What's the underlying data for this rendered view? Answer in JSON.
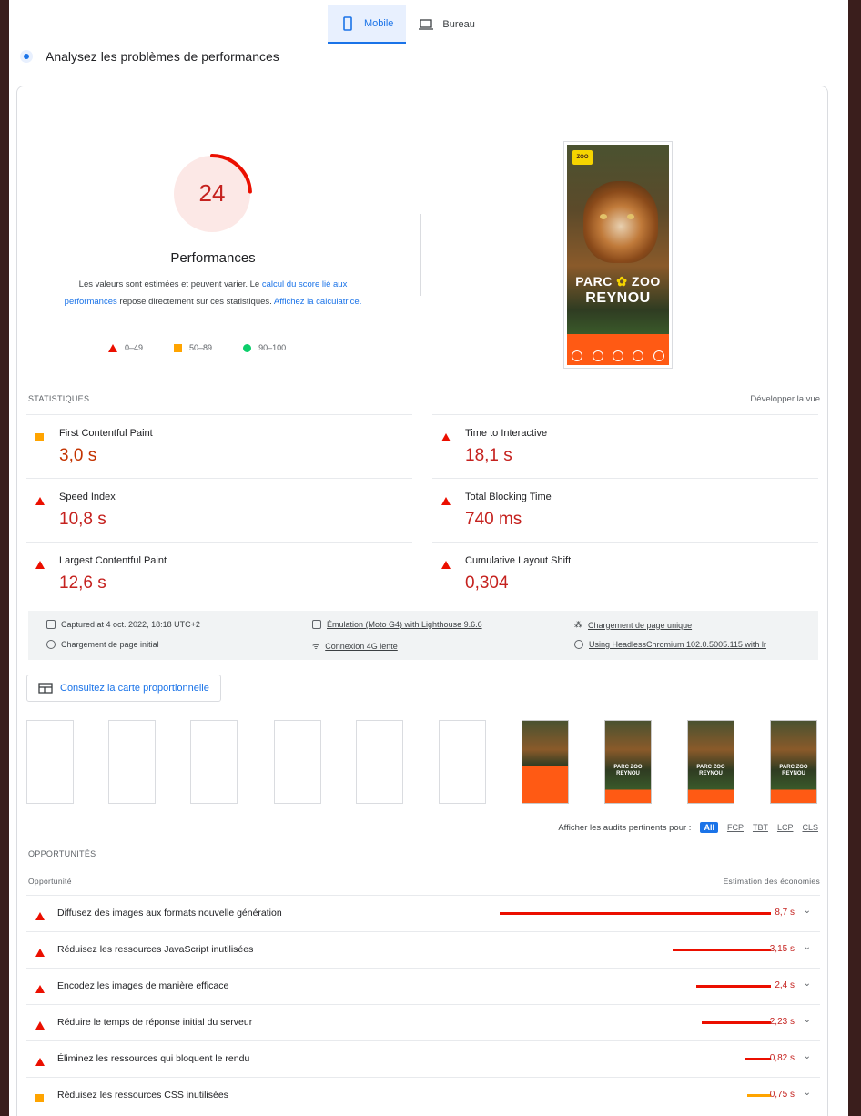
{
  "tabs": [
    {
      "label": "Mobile",
      "active": true
    },
    {
      "label": "Bureau",
      "active": false
    }
  ],
  "headline": "Analysez les problèmes de performances",
  "score": {
    "value": "24",
    "fraction": 0.24,
    "title": "Performances",
    "desc_1": "Les valeurs sont estimées et peuvent varier. Le ",
    "desc_link_1": "calcul du score lié aux performances",
    "desc_2": " repose directement sur ces statistiques. ",
    "desc_link_2": "Affichez la calculatrice."
  },
  "legend": {
    "low": "0–49",
    "mid": "50–89",
    "high": "90–100"
  },
  "screenshot": {
    "logo": "ZOO",
    "line1": "PARC",
    "line1b": "ZOO",
    "line2": "REYNOU"
  },
  "stats": {
    "label": "STATISTIQUES",
    "expand": "Développer la vue",
    "metrics": [
      {
        "name": "First Contentful Paint",
        "value": "3,0 s",
        "level": "average"
      },
      {
        "name": "Time to Interactive",
        "value": "18,1 s",
        "level": "fail"
      },
      {
        "name": "Speed Index",
        "value": "10,8 s",
        "level": "fail"
      },
      {
        "name": "Total Blocking Time",
        "value": "740 ms",
        "level": "fail"
      },
      {
        "name": "Largest Contentful Paint",
        "value": "12,6 s",
        "level": "fail"
      },
      {
        "name": "Cumulative Layout Shift",
        "value": "0,304",
        "level": "fail"
      }
    ]
  },
  "info": {
    "captured": "Captured at 4 oct. 2022, 18:18 UTC+2",
    "initial_load": "Chargement de page initial",
    "emulation": "Émulation (Moto G4) with Lighthouse 9.6.6",
    "connection": "Connexion 4G lente",
    "single_load": "Chargement de page unique",
    "browser": "Using HeadlessChromium 102.0.5005.115 with lr"
  },
  "treemap_label": "Consultez la carte proportionnelle",
  "filmstrip_text": "PARC ZOO REYNOU",
  "filters": {
    "label": "Afficher les audits pertinents pour :",
    "chips": [
      "All",
      "FCP",
      "TBT",
      "LCP",
      "CLS"
    ]
  },
  "opportunities": {
    "label": "OPPORTUNITÉS",
    "col_left": "Opportunité",
    "col_right": "Estimation des économies",
    "rows": [
      {
        "title": "Diffusez des images aux formats nouvelle génération",
        "value": "8,7 s",
        "seconds": 8.7,
        "level": "fail"
      },
      {
        "title": "Réduisez les ressources JavaScript inutilisées",
        "value": "3,15 s",
        "seconds": 3.15,
        "level": "fail"
      },
      {
        "title": "Encodez les images de manière efficace",
        "value": "2,4 s",
        "seconds": 2.4,
        "level": "fail"
      },
      {
        "title": "Réduire le temps de réponse initial du serveur",
        "value": "2,23 s",
        "seconds": 2.23,
        "level": "fail"
      },
      {
        "title": "Éliminez les ressources qui bloquent le rendu",
        "value": "0,82 s",
        "seconds": 0.82,
        "level": "fail"
      },
      {
        "title": "Réduisez les ressources CSS inutilisées",
        "value": "0,75 s",
        "seconds": 0.75,
        "level": "average"
      }
    ]
  },
  "colors": {
    "fail": "#eb0f00",
    "average": "#ffa400",
    "pass": "#0cce6b",
    "accent": "#1a73e8"
  }
}
